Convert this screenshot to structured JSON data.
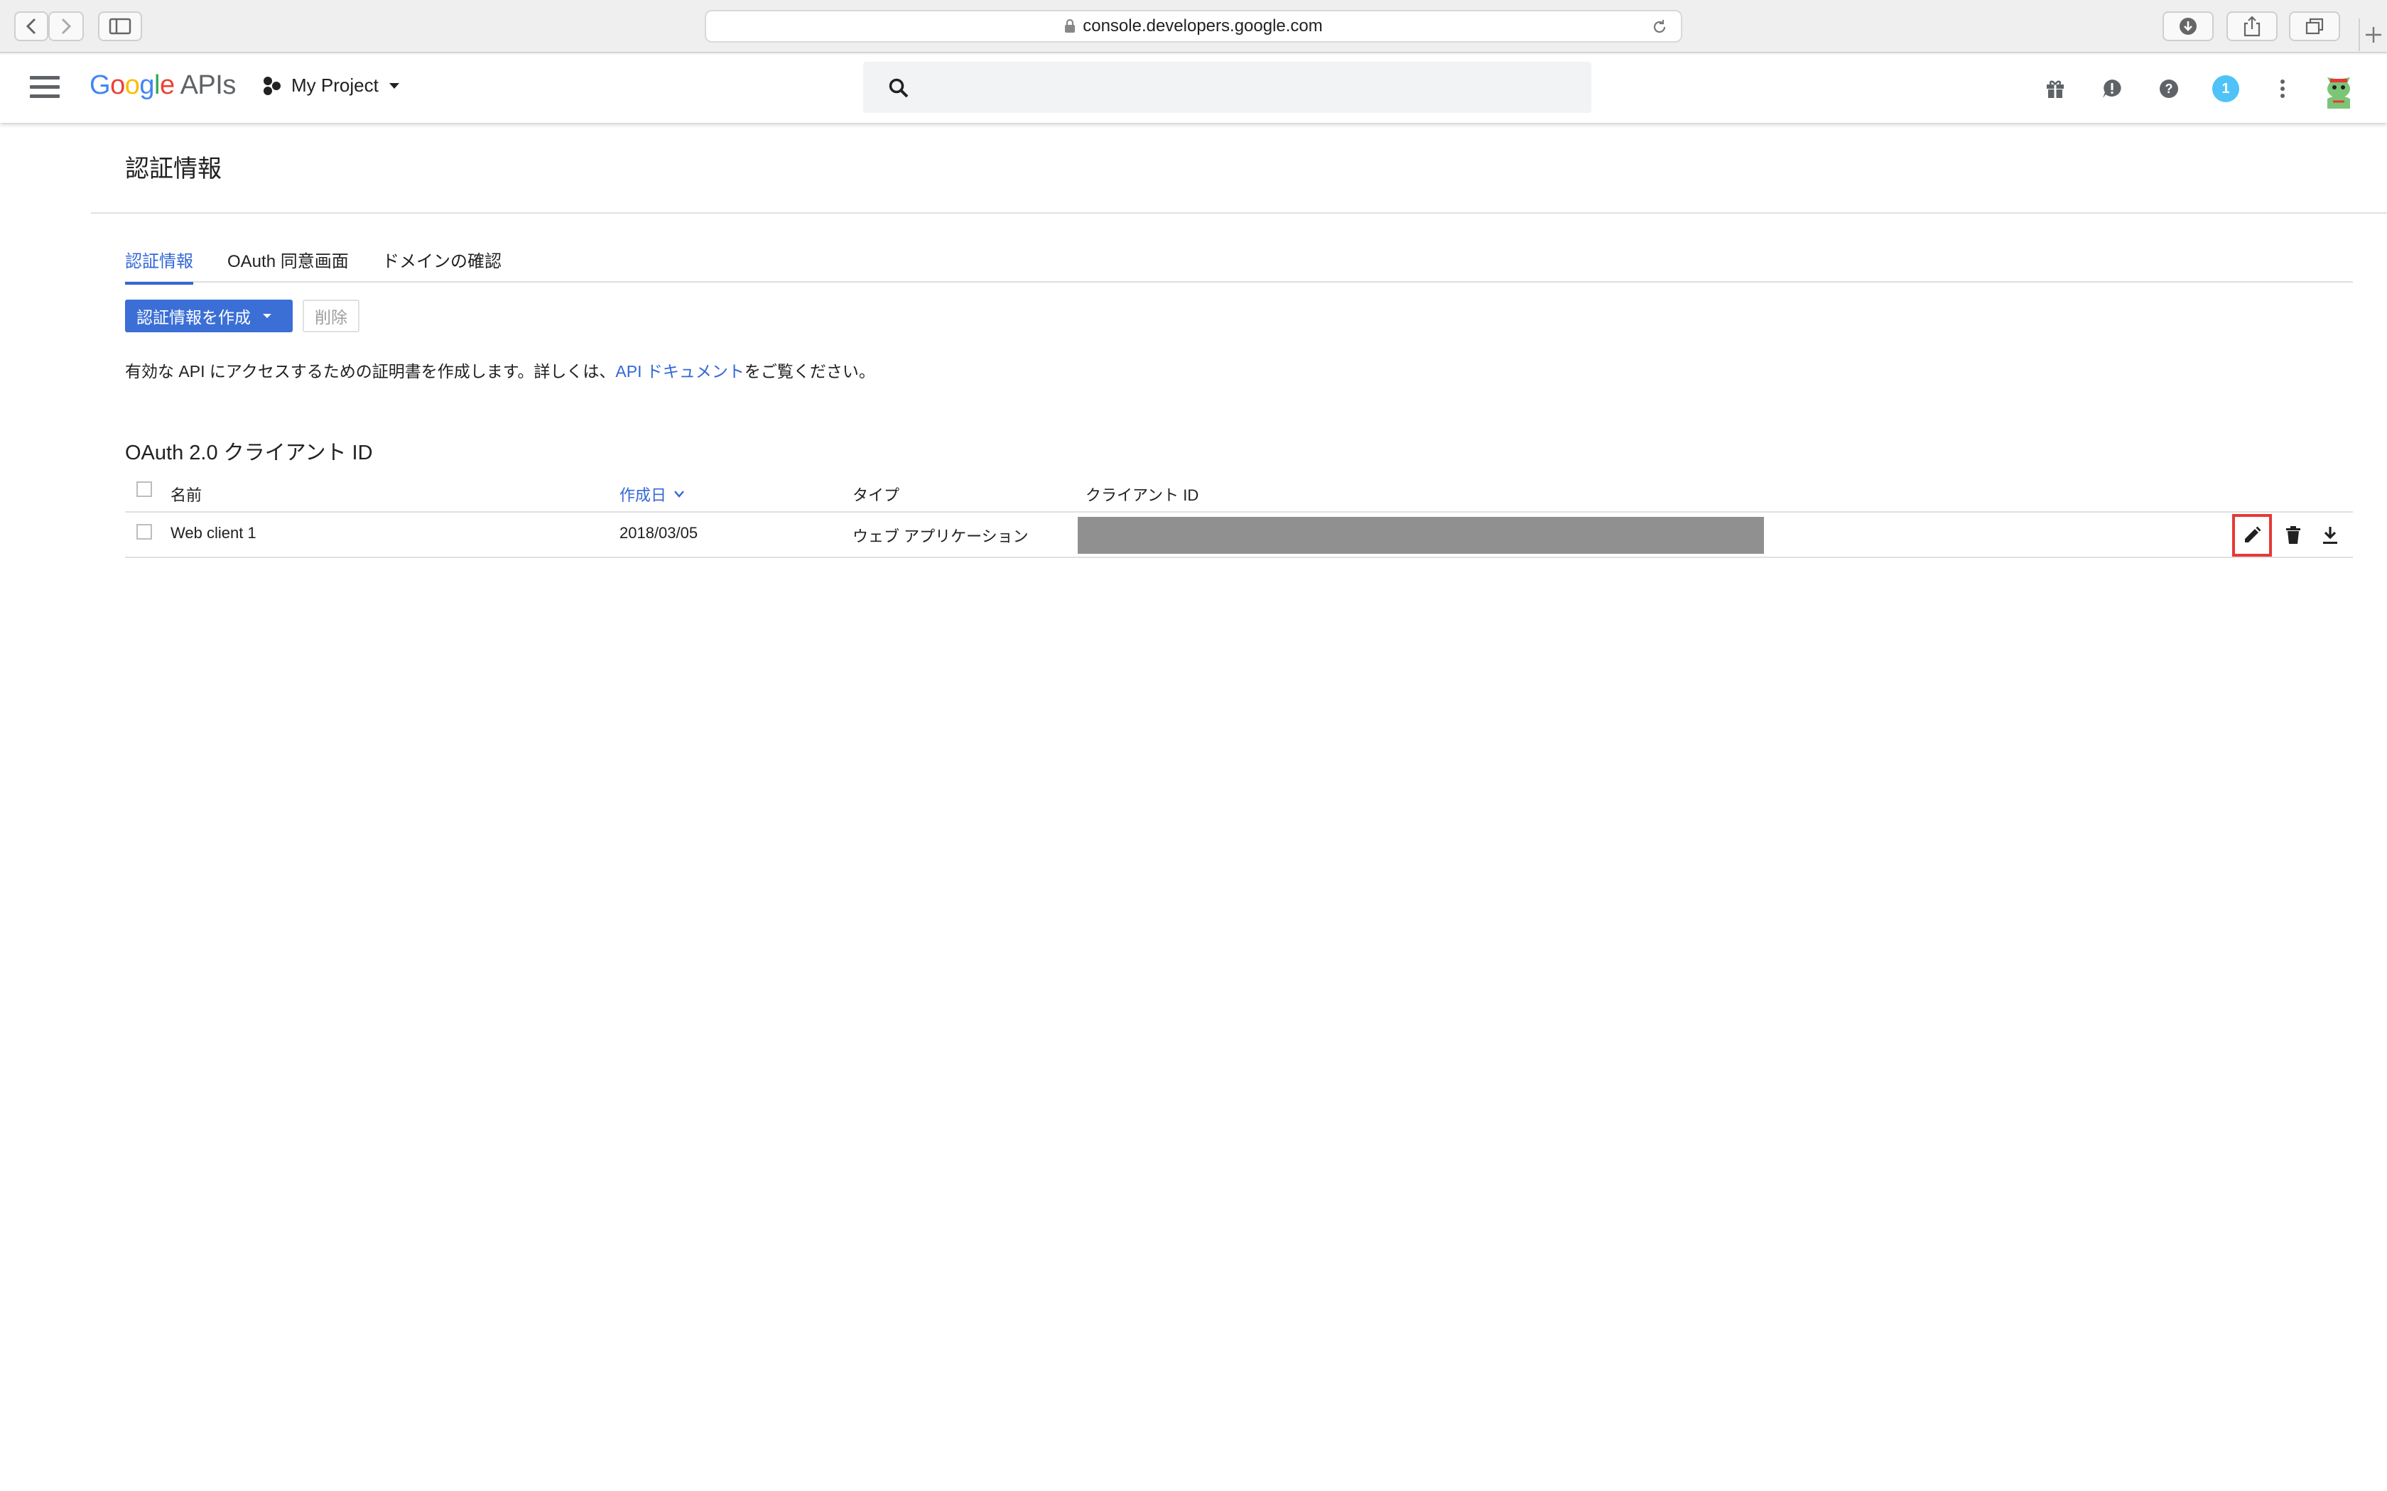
{
  "browser": {
    "url": "console.developers.google.com"
  },
  "header": {
    "logo_google": [
      "G",
      "o",
      "o",
      "g",
      "l",
      "e"
    ],
    "logo_suffix": "APIs",
    "project_name": "My Project",
    "notification_count": "1"
  },
  "page": {
    "title": "認証情報",
    "tabs": [
      {
        "label": "認証情報",
        "active": true
      },
      {
        "label": "OAuth 同意画面",
        "active": false
      },
      {
        "label": "ドメインの確認",
        "active": false
      }
    ],
    "create_button": "認証情報を作成",
    "delete_button": "削除",
    "description_prefix": "有効な API にアクセスするための証明書を作成します。詳しくは、",
    "description_link": "API ドキュメント",
    "description_suffix": "をご覧ください。"
  },
  "oauth_section": {
    "title": "OAuth 2.0 クライアント ID",
    "columns": {
      "name": "名前",
      "created": "作成日",
      "type": "タイプ",
      "client_id": "クライアント ID"
    },
    "rows": [
      {
        "name": "Web client 1",
        "created": "2018/03/05",
        "type": "ウェブ アプリケーション",
        "client_id": ""
      }
    ]
  },
  "colors": {
    "accent": "#3367d6",
    "highlight": "#e53935",
    "redaction": "#909090"
  }
}
